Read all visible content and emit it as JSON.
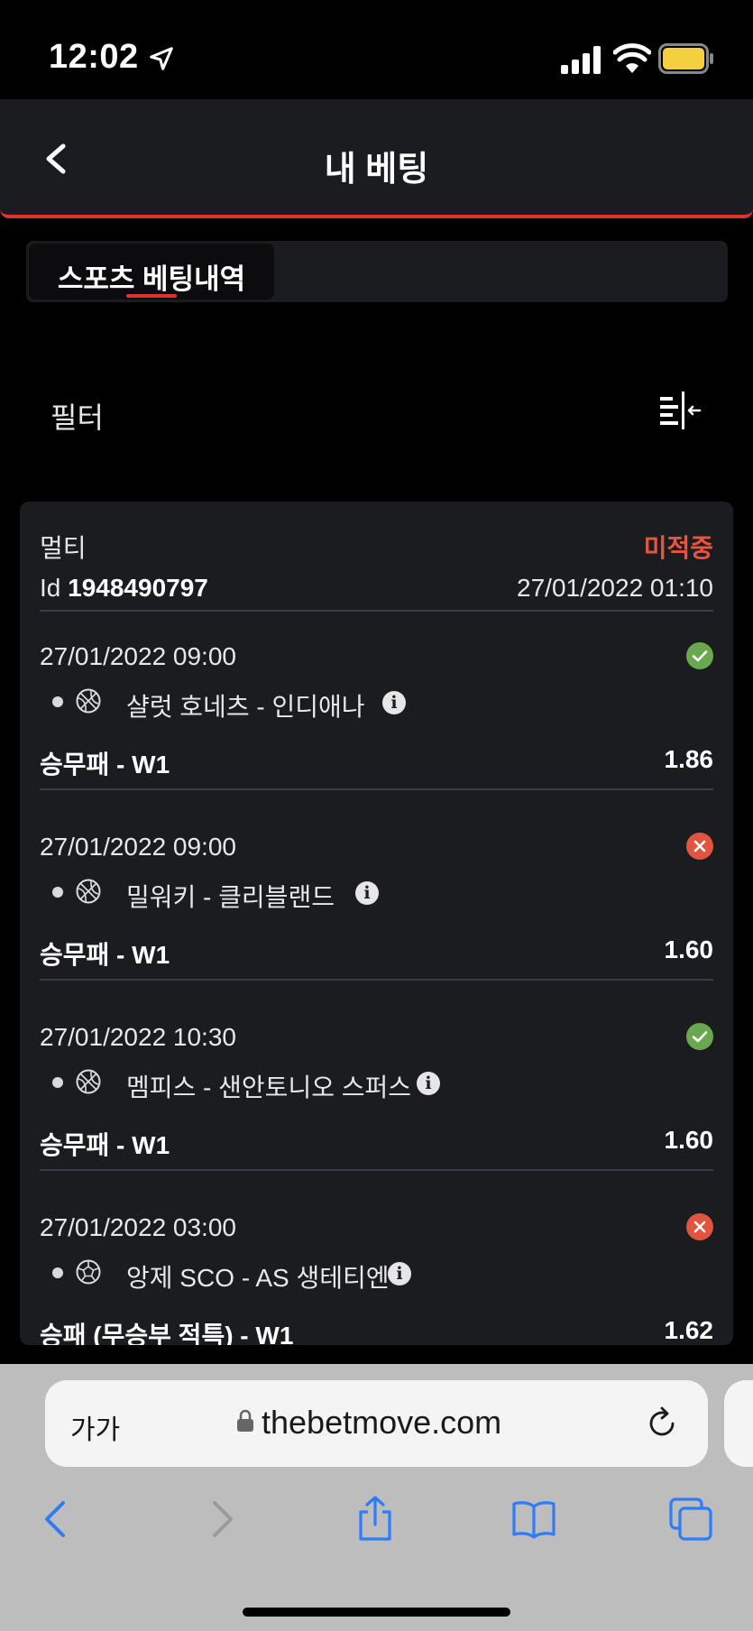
{
  "status_bar": {
    "time": "12:02"
  },
  "header": {
    "title": "내 베팅"
  },
  "tabs": [
    {
      "label": "스포츠 베팅내역",
      "active": true
    }
  ],
  "filter": {
    "label": "필터"
  },
  "bet": {
    "type": "멀티",
    "status": "미적중",
    "id_prefix": "Id",
    "id": "1948490797",
    "date": "27/01/2022 01:10",
    "selections": [
      {
        "date": "27/01/2022 09:00",
        "result": "win",
        "sport": "basketball",
        "match": "샬럿 호네츠 - 인디애나",
        "market": "승무패 - W1",
        "odds": "1.86"
      },
      {
        "date": "27/01/2022 09:00",
        "result": "loss",
        "sport": "basketball",
        "match": "밀워키 - 클리블랜드",
        "market": "승무패 - W1",
        "odds": "1.60"
      },
      {
        "date": "27/01/2022 10:30",
        "result": "win",
        "sport": "basketball",
        "match": "멤피스 - 샌안토니오 스퍼스",
        "market": "승무패 - W1",
        "odds": "1.60"
      },
      {
        "date": "27/01/2022 03:00",
        "result": "loss",
        "sport": "soccer",
        "match": "앙제 SCO - AS 생테티엔",
        "market": "승패 (무승부 적특) - W1",
        "odds": "1.62"
      }
    ]
  },
  "browser": {
    "text_size_label": "가가",
    "url": "thebetmove.com"
  },
  "colors": {
    "accent": "#e0332c",
    "win": "#6aa84f",
    "loss": "#e0553f",
    "card": "#1b1c20",
    "browser_blue": "#2f7cf6"
  }
}
